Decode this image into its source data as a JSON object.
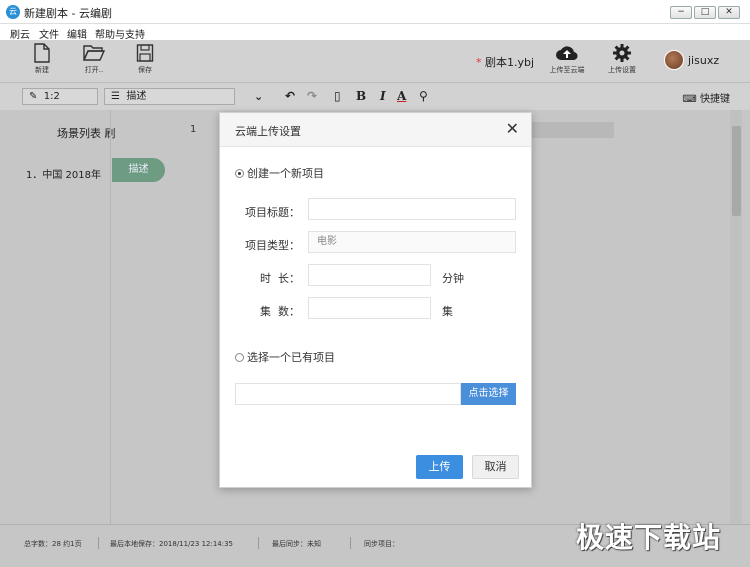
{
  "window": {
    "app_icon": "云",
    "title": "新建剧本 - 云编剧",
    "minimize": "−",
    "maximize": "□",
    "close": "✕"
  },
  "menu": [
    "刷云",
    "文件",
    "编辑",
    "帮助与支持"
  ],
  "toolbar": {
    "new_label": "新建",
    "open_label": "打开..",
    "save_label": "保存",
    "script_star": "*",
    "script_name": "剧本1.ybj",
    "upload_cloud_label": "上传至云端",
    "upload_settings_label": "上传设置",
    "username": "jisuxz"
  },
  "formatbar": {
    "ratio": "1:2",
    "style_select": "描述",
    "bold": "B",
    "italic": "I",
    "color": "A",
    "shortcut_label": "快捷键"
  },
  "main": {
    "scene_list_title": "场景列表",
    "scene_list_suffix": "刷",
    "scene_item": "1．中国 2018年",
    "tag_label": "描述",
    "line_number": "1"
  },
  "status": {
    "word_count": "总字数：28 约1页",
    "last_save": "最后本地保存：2018/11/23 12:14:35",
    "last_sync": "最后同步：未知",
    "sync_project": "同步项目：",
    "watermark": "极速下载站"
  },
  "dialog": {
    "title": "云端上传设置",
    "close": "✕",
    "option_new": "创建一个新项目",
    "field_title_label": "项目标题：",
    "field_title_value": "",
    "field_type_label": "项目类型：",
    "field_type_value": "电影",
    "field_duration_label": "时  长：",
    "field_duration_value": "",
    "duration_unit": "分钟",
    "field_episodes_label": "集  数：",
    "field_episodes_value": "",
    "episodes_unit": "集",
    "option_existing": "选择一个已有项目",
    "pick_button": "点击选择",
    "upload_button": "上传",
    "cancel_button": "取消"
  }
}
